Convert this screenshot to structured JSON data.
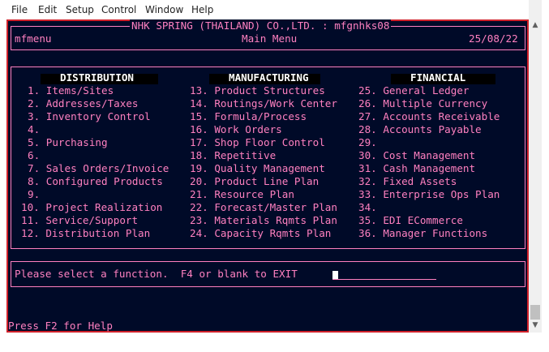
{
  "menubar": {
    "items": [
      "File",
      "Edit",
      "Setup",
      "Control",
      "Window",
      "Help"
    ]
  },
  "header": {
    "title": "NHK SPRING (THAILAND) CO.,LTD. : mfgnhks08",
    "program": "mfmenu",
    "screen": "Main Menu",
    "date": "25/08/22"
  },
  "columns": [
    {
      "heading": "DISTRIBUTION",
      "items": [
        "1. Items/Sites",
        "2. Addresses/Taxes",
        "3. Inventory Control",
        "4.",
        "5. Purchasing",
        "6.",
        "7. Sales Orders/Invoice",
        "8. Configured Products",
        "9.",
        "10. Project Realization",
        "11. Service/Support",
        "12. Distribution Plan"
      ]
    },
    {
      "heading": "MANUFACTURING",
      "items": [
        "13. Product Structures",
        "14. Routings/Work Center",
        "15. Formula/Process",
        "16. Work Orders",
        "17. Shop Floor Control",
        "18. Repetitive",
        "19. Quality Management",
        "20. Product Line Plan",
        "21. Resource Plan",
        "22. Forecast/Master Plan",
        "23. Materials Rqmts Plan",
        "24. Capacity Rqmts Plan"
      ]
    },
    {
      "heading": "FINANCIAL",
      "items": [
        "25. General Ledger",
        "26. Multiple Currency",
        "27. Accounts Receivable",
        "28. Accounts Payable",
        "29.",
        "30. Cost Management",
        "31. Cash Management",
        "32. Fixed Assets",
        "33. Enterprise Ops Plan",
        "34.",
        "35. EDI ECommerce",
        "36. Manager Functions"
      ]
    }
  ],
  "prompt": {
    "text": "Please select a function.  F4 or blank to EXIT",
    "value": ""
  },
  "footer": {
    "help": "Press F2 for Help"
  },
  "colors": {
    "terminal_bg": "#000a28",
    "terminal_fg": "#ff80c0",
    "frame": "#d0202a"
  }
}
